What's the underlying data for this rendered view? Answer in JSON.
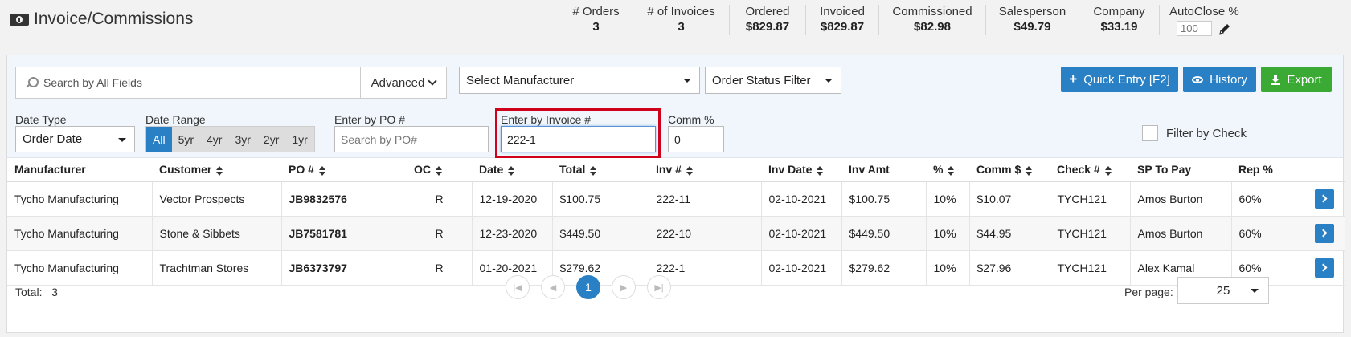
{
  "header": {
    "title": "Invoice/Commissions",
    "stats": [
      {
        "label": "# Orders",
        "value": "3"
      },
      {
        "label": "# of Invoices",
        "value": "3"
      },
      {
        "label": "Ordered",
        "value": "$829.87"
      },
      {
        "label": "Invoiced",
        "value": "$829.87"
      },
      {
        "label": "Commissioned",
        "value": "$82.98"
      },
      {
        "label": "Salesperson",
        "value": "$49.79"
      },
      {
        "label": "Company",
        "value": "$33.19"
      }
    ],
    "autoclose": {
      "label": "AutoClose %",
      "placeholder": "100"
    }
  },
  "filters": {
    "search_placeholder": "Search by All Fields",
    "advanced_label": "Advanced",
    "manufacturer_select": "Select Manufacturer",
    "order_status_select": "Order Status Filter",
    "quick_entry_label": "Quick Entry [F2]",
    "history_label": "History",
    "export_label": "Export",
    "date_type_label": "Date Type",
    "date_type_value": "Order Date",
    "date_range_label": "Date Range",
    "date_ranges": [
      "All",
      "5yr",
      "4yr",
      "3yr",
      "2yr",
      "1yr"
    ],
    "po_label": "Enter by PO #",
    "po_placeholder": "Search by PO#",
    "invoice_label": "Enter by Invoice #",
    "invoice_value": "222-1",
    "comm_label": "Comm %",
    "comm_value": "0",
    "filter_by_check_label": "Filter by Check"
  },
  "table": {
    "columns": [
      "Manufacturer",
      "Customer",
      "PO #",
      "OC",
      "Date",
      "Total",
      "Inv #",
      "Inv Date",
      "Inv Amt",
      "%",
      "Comm $",
      "Check #",
      "SP To Pay",
      "Rep %"
    ],
    "rows": [
      [
        "Tycho Manufacturing",
        "Vector Prospects",
        "JB9832576",
        "R",
        "12-19-2020",
        "$100.75",
        "222-11",
        "02-10-2021",
        "$100.75",
        "10%",
        "$10.07",
        "TYCH121",
        "Amos Burton",
        "60%"
      ],
      [
        "Tycho Manufacturing",
        "Stone & Sibbets",
        "JB7581781",
        "R",
        "12-23-2020",
        "$449.50",
        "222-10",
        "02-10-2021",
        "$449.50",
        "10%",
        "$44.95",
        "TYCH121",
        "Amos Burton",
        "60%"
      ],
      [
        "Tycho Manufacturing",
        "Trachtman Stores",
        "JB6373797",
        "R",
        "01-20-2021",
        "$279.62",
        "222-1",
        "02-10-2021",
        "$279.62",
        "10%",
        "$27.96",
        "TYCH121",
        "Alex Kamal",
        "60%"
      ]
    ]
  },
  "footer": {
    "total_label": "Total:",
    "total_value": "3",
    "current_page": "1",
    "per_page_label": "Per page:",
    "per_page_value": "25"
  },
  "colors": {
    "primary": "#2a80c4",
    "success": "#3aaa35",
    "highlight": "#d0021b"
  }
}
